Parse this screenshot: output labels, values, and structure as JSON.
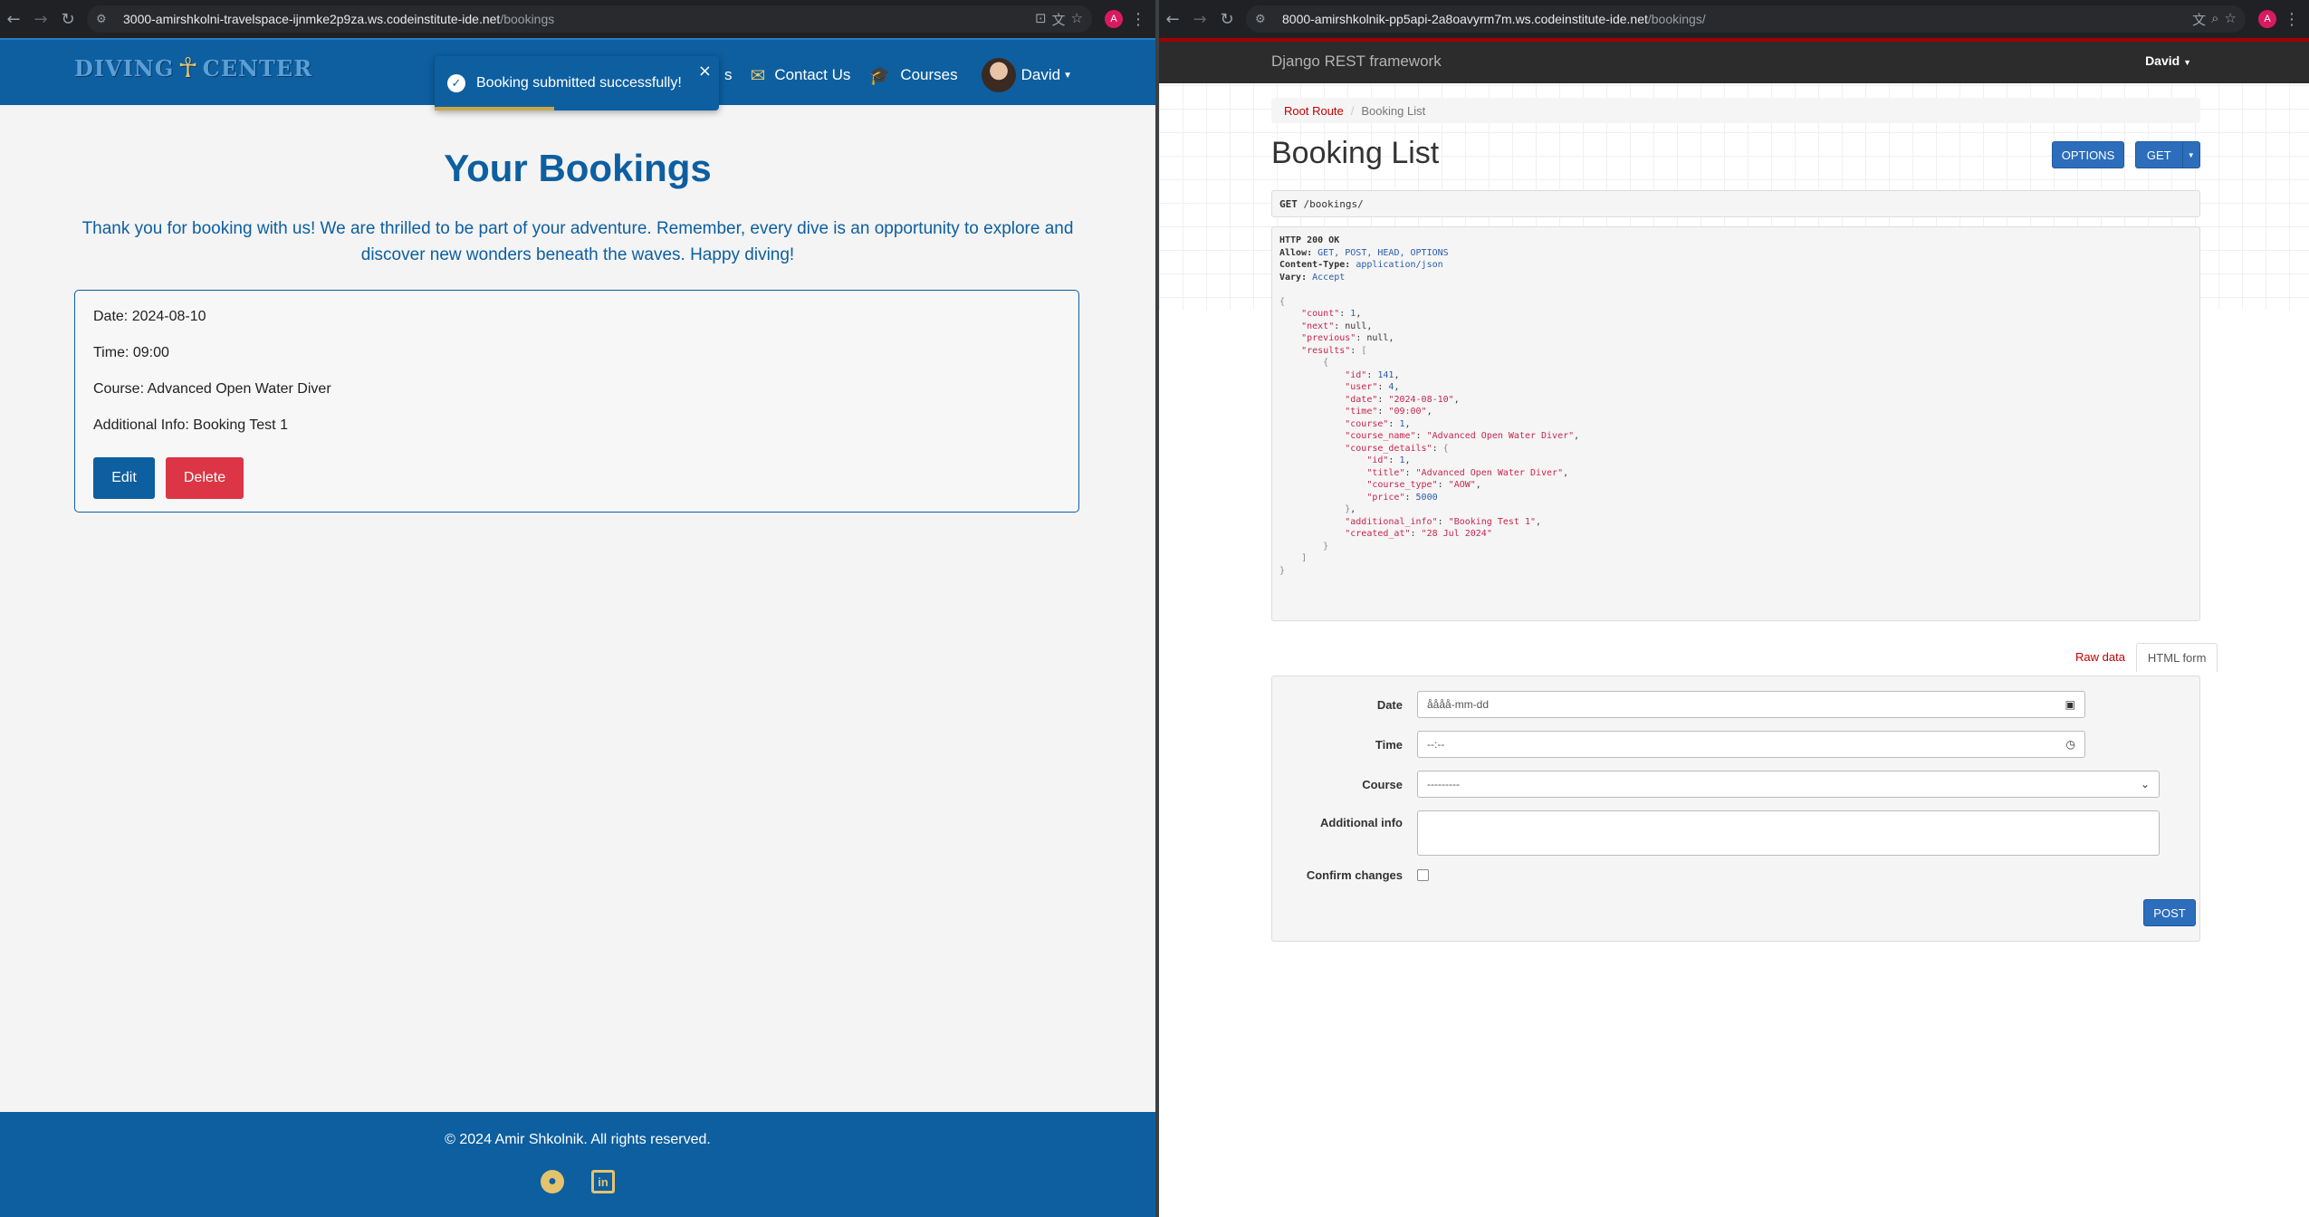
{
  "left_browser": {
    "url_host": "3000-amirshkolni-travelspace-ijnmke2p9za.ws.codeinstitute-ide.net",
    "url_path": "/bookings",
    "profile_initial": "A"
  },
  "right_browser": {
    "url_host": "8000-amirshkolnik-pp5api-2a8oavyrm7m.ws.codeinstitute-ide.net",
    "url_path": "/bookings/",
    "profile_initial": "A"
  },
  "site": {
    "logo_text_1": "DIVING",
    "logo_text_2": "CENTER",
    "nav": {
      "partial_link": "s",
      "contact": "Contact Us",
      "courses": "Courses",
      "user": "David"
    },
    "toast": {
      "message": "Booking submitted successfully!",
      "progress_percent": 42
    },
    "page_title": "Your Bookings",
    "intro": "Thank you for booking with us! We are thrilled to be part of your adventure. Remember, every dive is an opportunity to explore and discover new wonders beneath the waves. Happy diving!",
    "booking": {
      "date": "Date: 2024-08-10",
      "time": "Time: 09:00",
      "course": "Course: Advanced Open Water Diver",
      "additional_info": "Additional Info: Booking Test 1",
      "edit_label": "Edit",
      "delete_label": "Delete"
    },
    "footer": {
      "copyright": "© 2024 Amir Shkolnik. All rights reserved.",
      "icons": [
        "github-icon",
        "linkedin-icon"
      ]
    },
    "colors": {
      "primary": "#0d5fa0",
      "accent": "#e4c36f",
      "danger": "#dc3545"
    }
  },
  "drf": {
    "brand": "Django REST framework",
    "user": "David",
    "breadcrumb": [
      "Root Route",
      "Booking List"
    ],
    "title": "Booking List",
    "options_label": "OPTIONS",
    "get_label": "GET",
    "request_method": "GET",
    "request_path": "/bookings/",
    "status": "HTTP 200 OK",
    "headers": [
      {
        "name": "Allow:",
        "value": "GET, POST, HEAD, OPTIONS"
      },
      {
        "name": "Content-Type:",
        "value": "application/json"
      },
      {
        "name": "Vary:",
        "value": "Accept"
      }
    ],
    "response": {
      "count": 1,
      "next": "null",
      "previous": "null",
      "result": {
        "id": 141,
        "user": 4,
        "date": "2024-08-10",
        "time": "09:00",
        "course": 1,
        "course_name": "Advanced Open Water Diver",
        "course_details": {
          "id": 1,
          "title": "Advanced Open Water Diver",
          "course_type": "AOW",
          "price": 5000
        },
        "additional_info": "Booking Test 1",
        "created_at": "28 Jul 2024"
      }
    },
    "tabs": {
      "raw": "Raw data",
      "html": "HTML form"
    },
    "form": {
      "date_label": "Date",
      "date_placeholder": "åååå-mm-dd",
      "time_label": "Time",
      "time_placeholder": "--:--",
      "course_label": "Course",
      "course_value": "---------",
      "additional_label": "Additional info",
      "confirm_label": "Confirm changes",
      "post_label": "POST"
    }
  }
}
